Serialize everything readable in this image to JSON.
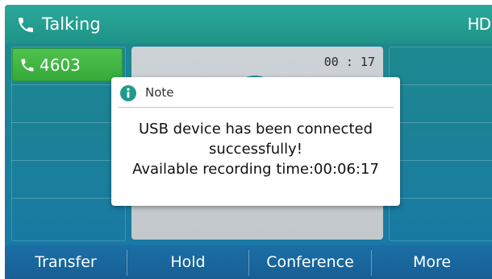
{
  "header": {
    "call_state": "Talking",
    "call_state_icon": "phone-handset-icon",
    "hd_badge": "HD"
  },
  "line_key": {
    "label": "4603",
    "icon": "phone-handset-icon",
    "color": "#3db43f"
  },
  "call": {
    "duration": "00 : 17"
  },
  "dialog": {
    "title": "Note",
    "icon": "info-icon",
    "icon_color": "#1f9a8c",
    "message_lines": [
      "USB device has been connected",
      "successfully!",
      "Available recording time:00:06:17"
    ]
  },
  "softkeys": [
    {
      "label": "Transfer"
    },
    {
      "label": "Hold"
    },
    {
      "label": "Conference"
    },
    {
      "label": "More"
    }
  ],
  "colors": {
    "title_bar": "#24a090",
    "background": "#1b8296",
    "softkey_bar": "#1a6aa0"
  }
}
